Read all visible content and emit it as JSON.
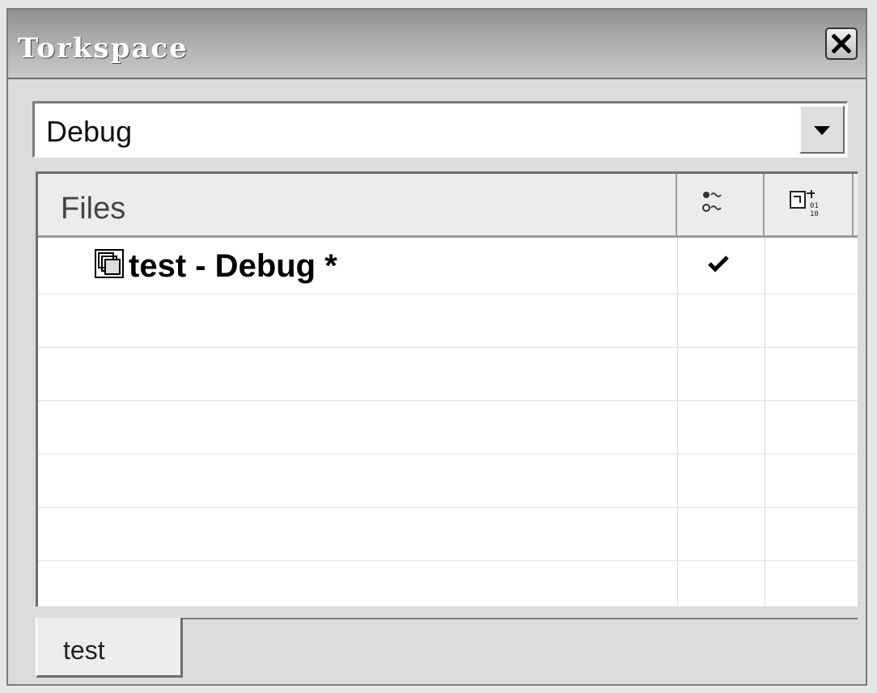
{
  "window": {
    "title": "Torkspace"
  },
  "config_combo": {
    "value": "Debug"
  },
  "tree": {
    "header": {
      "files_label": "Files",
      "col2_icon": "build-flags-icon",
      "col3_icon": "binary-file-icon"
    },
    "project": {
      "label": "test - Debug *",
      "icon": "project-icon",
      "checked": true
    }
  },
  "tabs": [
    {
      "label": "test",
      "active": true
    }
  ],
  "colors": {
    "title_gradient_dark": "#8f8f8f",
    "title_gradient_light": "#c9c9c9",
    "panel_bg": "#dcdcdc",
    "list_bg": "#ffffff"
  }
}
